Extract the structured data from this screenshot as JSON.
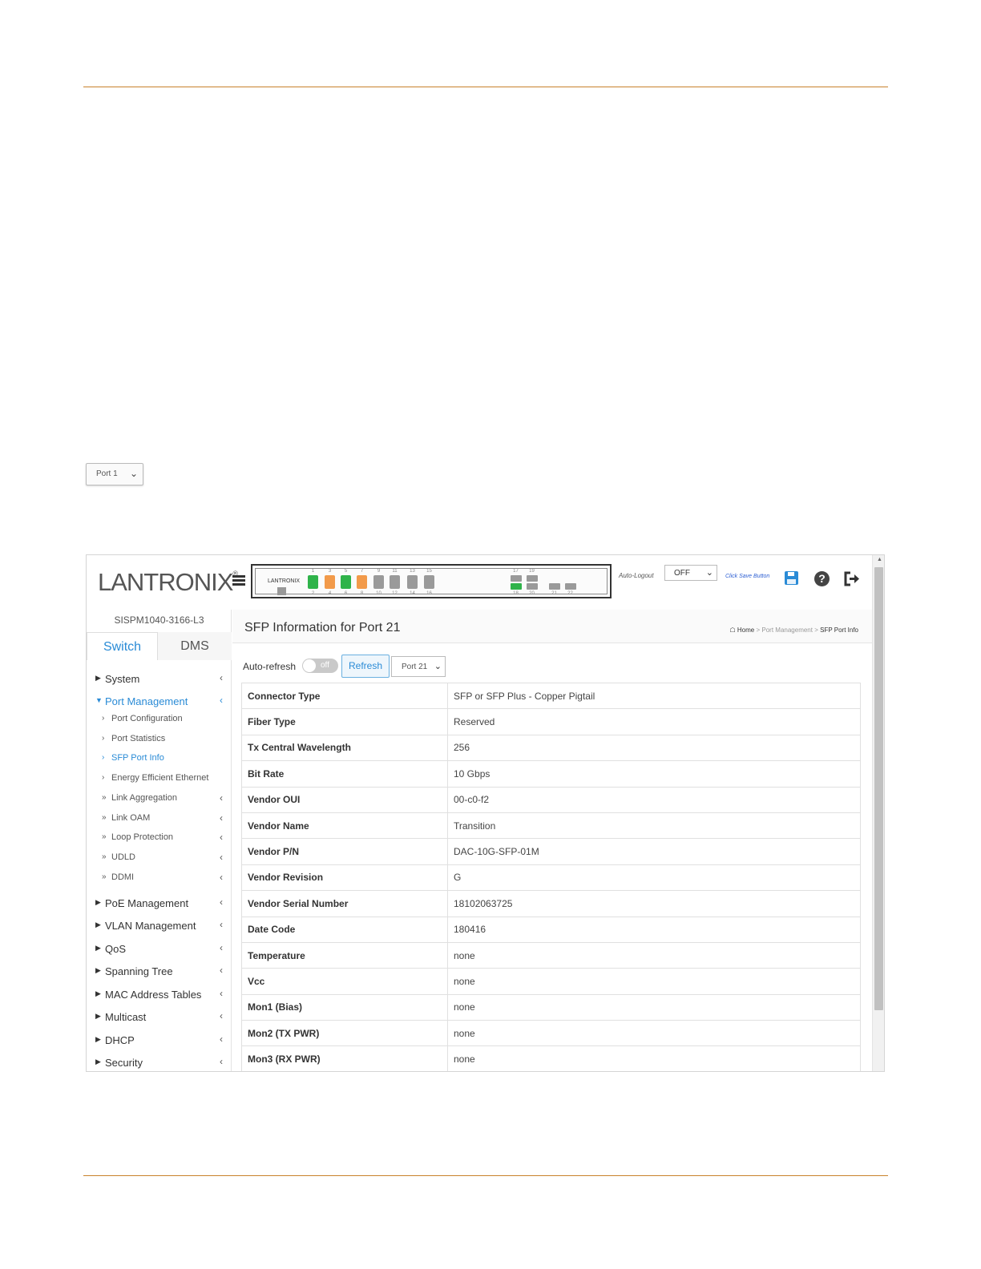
{
  "doc_select": {
    "value": "Port 1"
  },
  "header": {
    "brand": "LANTRONIX",
    "panel_brand": "LANTRONIX",
    "port_numbers_top": [
      "1",
      "3",
      "5",
      "7",
      "9",
      "11",
      "13",
      "15"
    ],
    "port_numbers_bottom": [
      "2",
      "4",
      "6",
      "8",
      "10",
      "12",
      "14",
      "16"
    ],
    "sfp_numbers_top": [
      "17",
      "19"
    ],
    "sfp_numbers_bottom": [
      "18",
      "20",
      "21",
      "22"
    ],
    "auto_logout_label": "Auto-Logout",
    "auto_logout_value": "OFF",
    "save_text": "Click Save Button"
  },
  "sidebar": {
    "device_name": "SISPM1040-3166-L3",
    "tabs": {
      "switch": "Switch",
      "dms": "DMS"
    },
    "items": [
      {
        "label": "System"
      },
      {
        "label": "Port Management"
      },
      {
        "label": "PoE Management"
      },
      {
        "label": "VLAN Management"
      },
      {
        "label": "QoS"
      },
      {
        "label": "Spanning Tree"
      },
      {
        "label": "MAC Address Tables"
      },
      {
        "label": "Multicast"
      },
      {
        "label": "DHCP"
      },
      {
        "label": "Security"
      }
    ],
    "sub_items": [
      {
        "label": "Port Configuration"
      },
      {
        "label": "Port Statistics"
      },
      {
        "label": "SFP Port Info"
      },
      {
        "label": "Energy Efficient Ethernet"
      },
      {
        "label": "Link Aggregation"
      },
      {
        "label": "Link OAM"
      },
      {
        "label": "Loop Protection"
      },
      {
        "label": "UDLD"
      },
      {
        "label": "DDMI"
      }
    ]
  },
  "main": {
    "title": "SFP Information for  Port 21",
    "breadcrumb": {
      "home": "Home",
      "section": "Port Management",
      "current": "SFP Port Info"
    },
    "auto_refresh_label": "Auto-refresh",
    "toggle_text": "off",
    "refresh_label": "Refresh",
    "port_select_value": "Port 21",
    "rows": [
      {
        "key": "Connector Type",
        "value": "SFP or SFP Plus - Copper Pigtail"
      },
      {
        "key": "Fiber Type",
        "value": "Reserved"
      },
      {
        "key": "Tx Central Wavelength",
        "value": "256"
      },
      {
        "key": "Bit Rate",
        "value": "10 Gbps"
      },
      {
        "key": "Vendor OUI",
        "value": "00-c0-f2"
      },
      {
        "key": "Vendor Name",
        "value": "Transition"
      },
      {
        "key": "Vendor P/N",
        "value": "DAC-10G-SFP-01M"
      },
      {
        "key": "Vendor Revision",
        "value": "G"
      },
      {
        "key": "Vendor Serial Number",
        "value": "18102063725"
      },
      {
        "key": "Date Code",
        "value": "180416"
      },
      {
        "key": "Temperature",
        "value": "none"
      },
      {
        "key": "Vcc",
        "value": "none"
      },
      {
        "key": "Mon1 (Bias)",
        "value": "none"
      },
      {
        "key": "Mon2 (TX PWR)",
        "value": "none"
      },
      {
        "key": "Mon3 (RX PWR)",
        "value": "none"
      }
    ]
  },
  "colors": {
    "accent": "#2a8bd6",
    "rule": "#c8822c",
    "port_green": "#2fb34a",
    "port_orange": "#f29a4a",
    "port_gray": "#9a9a9a"
  }
}
